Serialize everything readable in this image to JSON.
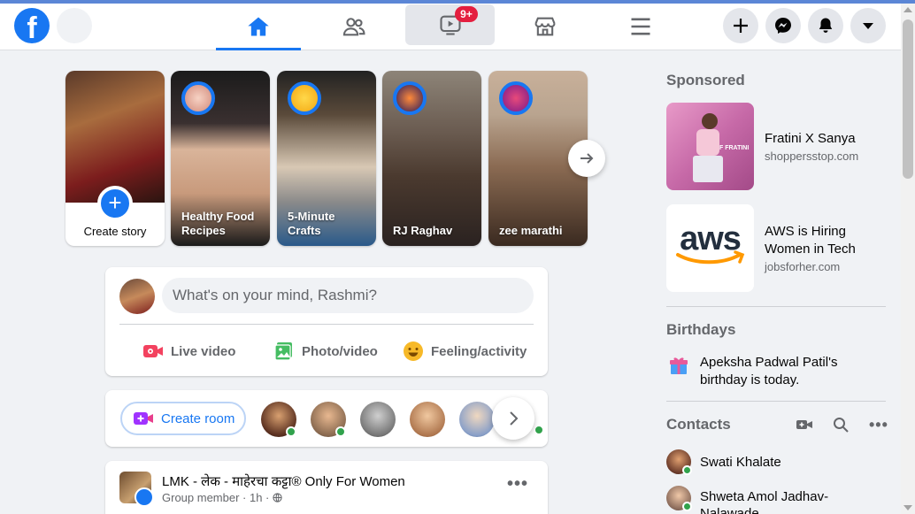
{
  "header": {
    "logo_letter": "f",
    "watch_badge": "9+"
  },
  "stories": [
    {
      "label": "Create story"
    },
    {
      "label": "Healthy Food Recipes"
    },
    {
      "label": "5-Minute Crafts"
    },
    {
      "label": "RJ Raghav"
    },
    {
      "label": "zee marathi"
    }
  ],
  "composer": {
    "placeholder": "What's on your mind, Rashmi?",
    "actions": [
      {
        "label": "Live video",
        "color": "#f3425f"
      },
      {
        "label": "Photo/video",
        "color": "#45bd62"
      },
      {
        "label": "Feeling/activity",
        "color": "#f7b928"
      }
    ]
  },
  "rooms": {
    "create_label": "Create room"
  },
  "post": {
    "group_name": "LMK - लेक - माहेरचा कट्टा® Only For Women",
    "meta": "Group member · 1h · ",
    "more": "•••"
  },
  "sidebar": {
    "sponsored_heading": "Sponsored",
    "ads": [
      {
        "title": "Fratini X Sanya",
        "url": "shoppersstop.com",
        "image_text": "F FRATINI"
      },
      {
        "title": "AWS is Hiring Women in Tech",
        "url": "jobsforher.com",
        "image_text": "aws"
      }
    ],
    "birthdays_heading": "Birthdays",
    "birthday_text": "Apeksha Padwal Patil's birthday is today.",
    "contacts_heading": "Contacts",
    "contacts": [
      {
        "name": "Swati Khalate"
      },
      {
        "name": "Shweta Amol Jadhav-Nalawade"
      }
    ]
  },
  "colors": {
    "brand": "#1877f2",
    "background": "#f0f2f5",
    "badge": "#e41e3f",
    "online": "#31a24c"
  }
}
